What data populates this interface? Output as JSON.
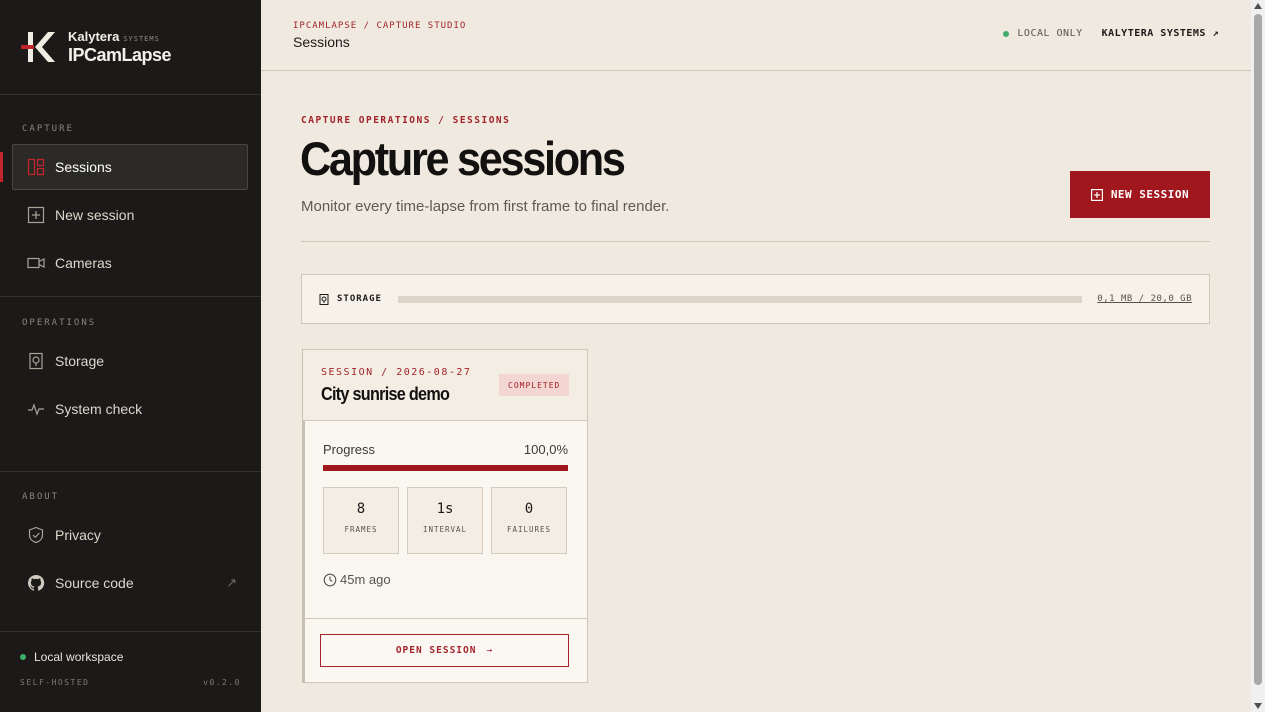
{
  "brand": {
    "company": "Kalytera",
    "systems": "SYSTEMS",
    "product": "IPCamLapse"
  },
  "sidebar": {
    "capture_heading": "CAPTURE",
    "capture_items": [
      {
        "label": "Sessions",
        "icon": "layout-icon",
        "active": true
      },
      {
        "label": "New session",
        "icon": "plus-square-icon"
      },
      {
        "label": "Cameras",
        "icon": "camera-icon"
      }
    ],
    "operations_heading": "OPERATIONS",
    "operations_items": [
      {
        "label": "Storage",
        "icon": "storage-icon"
      },
      {
        "label": "System check",
        "icon": "pulse-icon"
      }
    ],
    "about_heading": "ABOUT",
    "about_items": [
      {
        "label": "Privacy",
        "icon": "shield-icon"
      },
      {
        "label": "Source code",
        "icon": "github-icon",
        "external": "↗"
      }
    ],
    "footer": {
      "workspace": "Local workspace",
      "hosting": "SELF-HOSTED",
      "version": "v0.2.0"
    }
  },
  "topbar": {
    "breadcrumb": "IPCAMLAPSE / CAPTURE STUDIO",
    "title": "Sessions",
    "status": "LOCAL ONLY",
    "company_link": "KALYTERA SYSTEMS ↗"
  },
  "main": {
    "section_crumb": "CAPTURE OPERATIONS / SESSIONS",
    "title": "Capture sessions",
    "subtitle": "Monitor every time-lapse from first frame to final render.",
    "new_session_label": "NEW SESSION",
    "storage": {
      "label": "STORAGE",
      "value": "0,1 MB / 20,0 GB",
      "used_fraction": 5e-06
    }
  },
  "sessions": [
    {
      "meta": "SESSION / 2026-08-27",
      "title": "City sunrise demo",
      "status": "COMPLETED",
      "progress_label": "Progress",
      "progress_value": "100,0%",
      "progress_fraction": 1.0,
      "stats": [
        {
          "value": "8",
          "label": "FRAMES"
        },
        {
          "value": "1s",
          "label": "INTERVAL"
        },
        {
          "value": "0",
          "label": "FAILURES"
        }
      ],
      "ago": "45m ago",
      "open_label": "OPEN SESSION",
      "open_arrow": "→"
    }
  ],
  "colors": {
    "accent": "#a0171d",
    "sidebar_bg": "#1b1a18",
    "page_bg": "#efe9df",
    "status_green": "#3fae6a"
  }
}
